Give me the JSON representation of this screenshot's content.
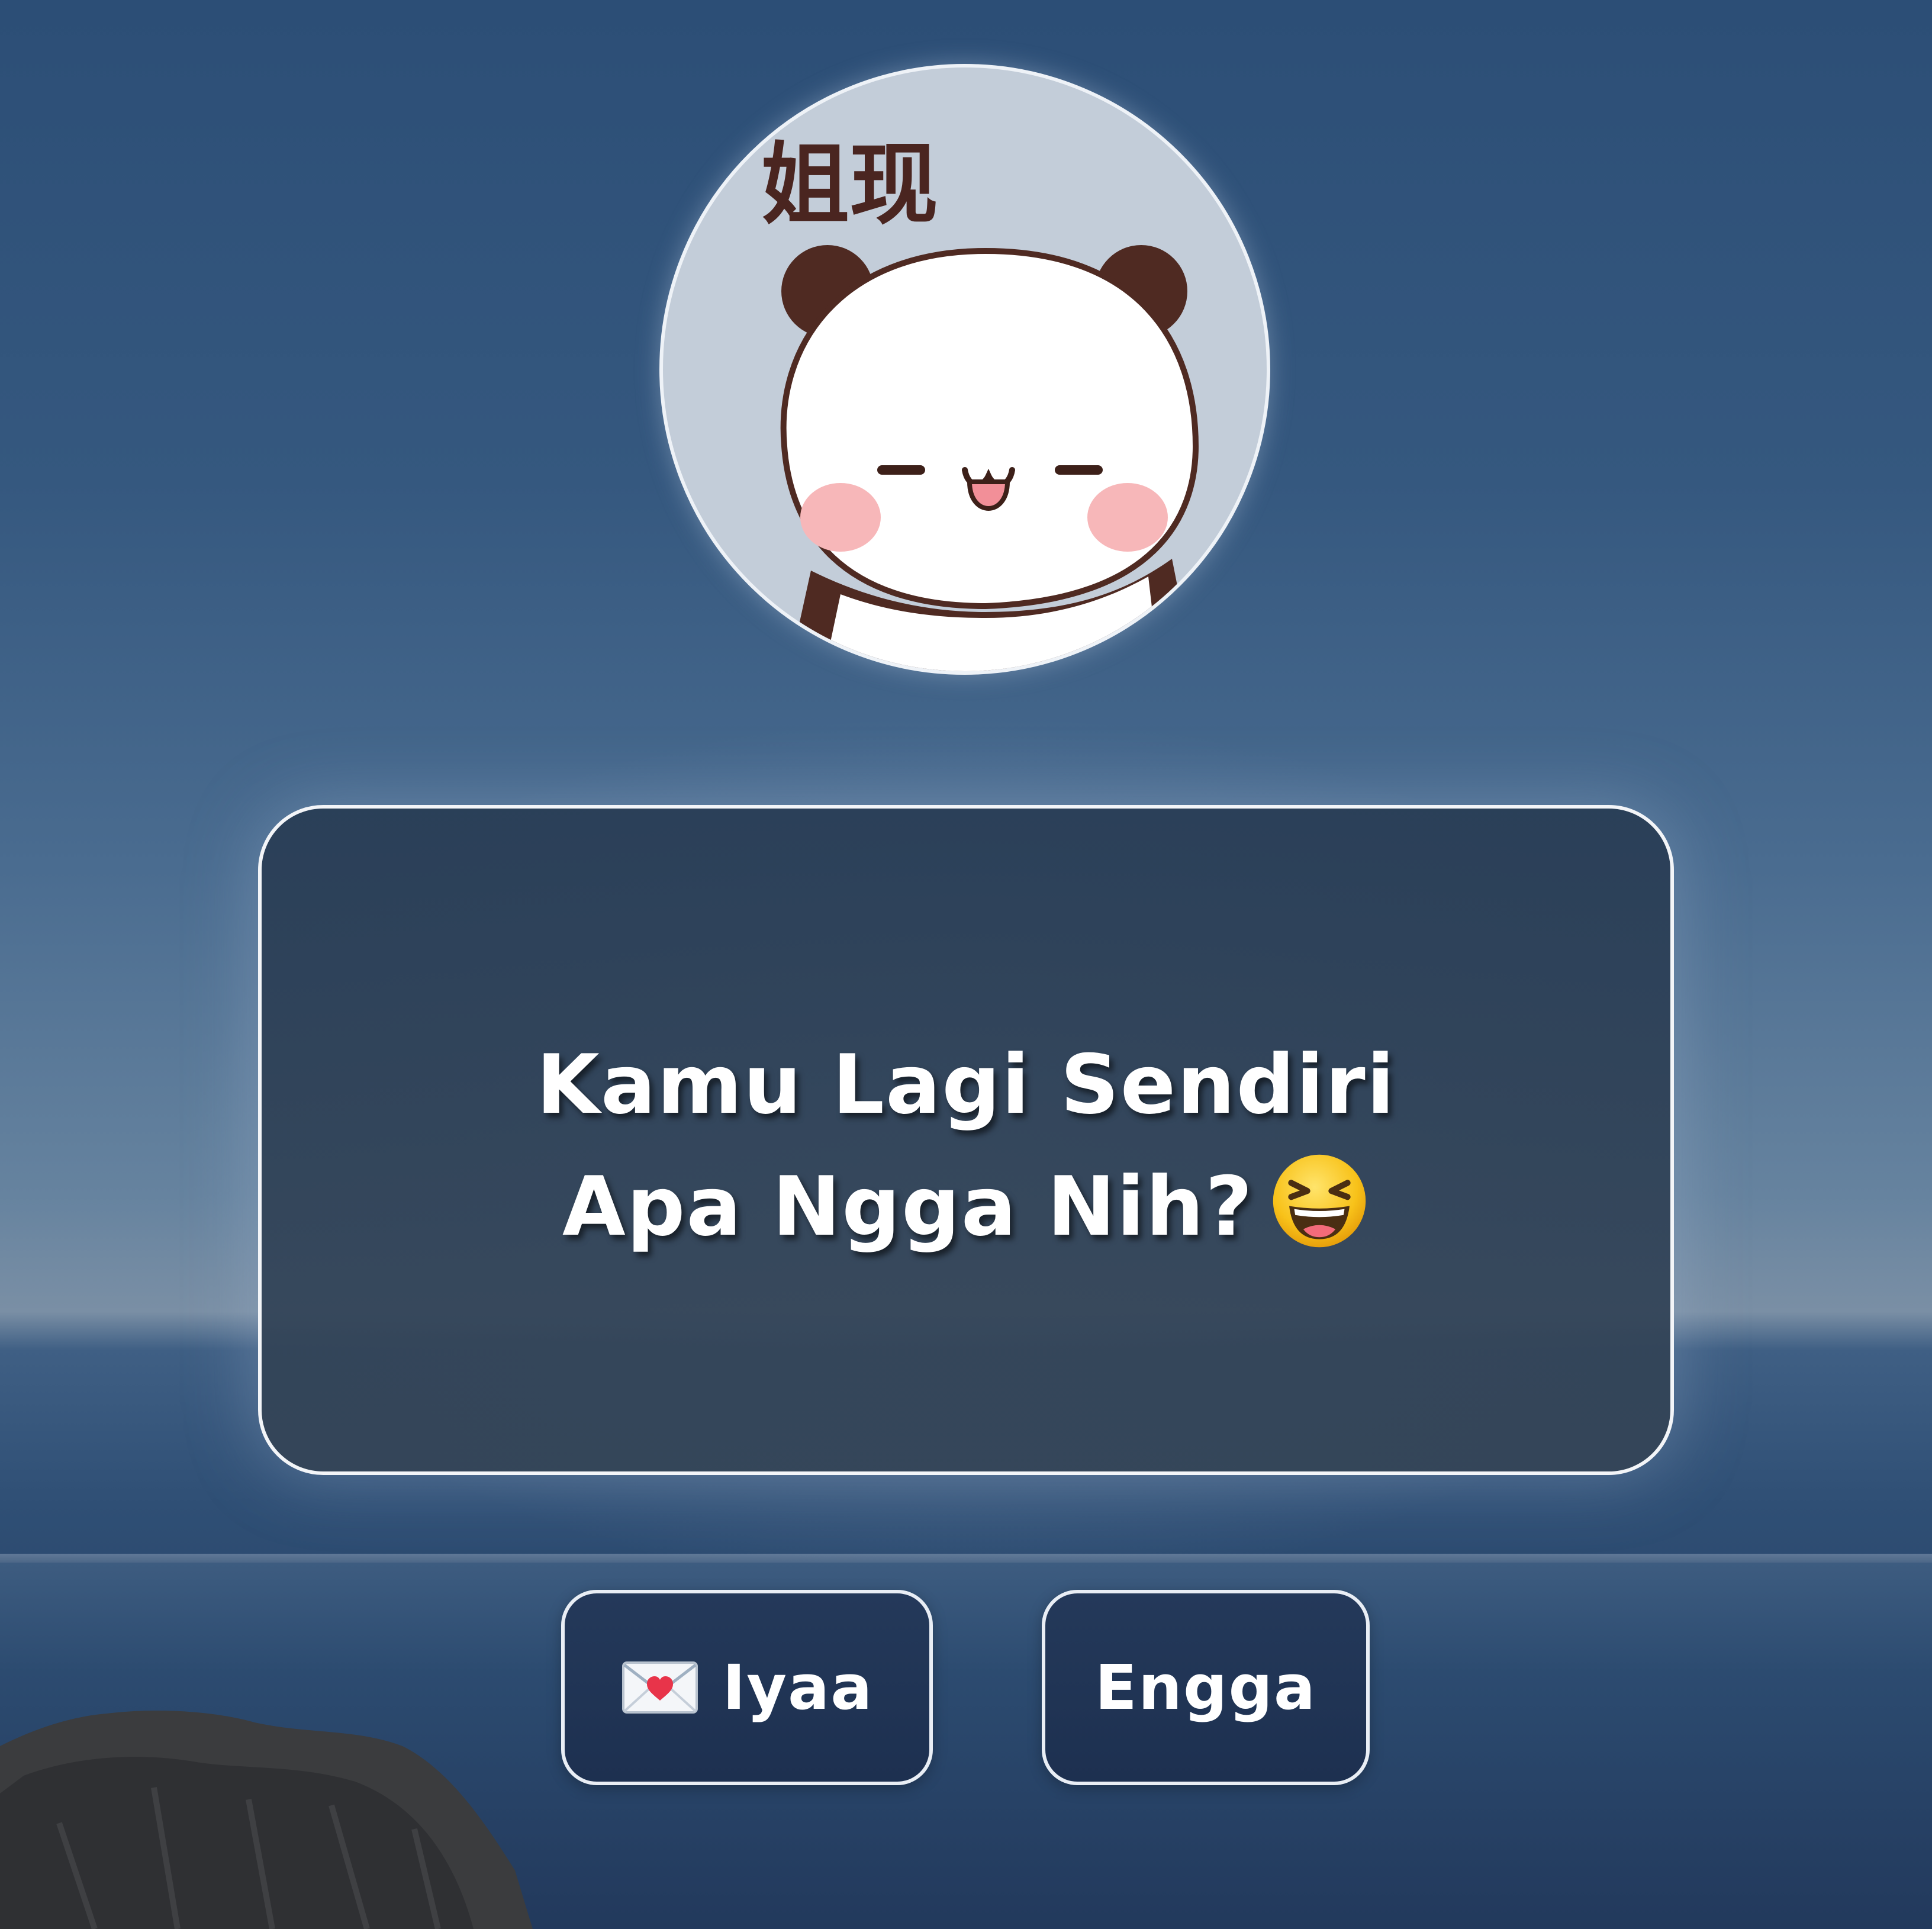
{
  "avatar": {
    "sticker_text": "姐现"
  },
  "card": {
    "line1": "Kamu Lagi Sendiri",
    "line2": "Apa Ngga Nih?",
    "emoji_icon": "grinning-squinting-face-icon"
  },
  "buttons": {
    "yes_label": "Iyaa",
    "yes_icon": "love-letter-icon",
    "no_label": "Engga"
  },
  "colors": {
    "card_border": "#f3f5f8",
    "button_bg": "#1d3050",
    "text": "#ffffff"
  }
}
